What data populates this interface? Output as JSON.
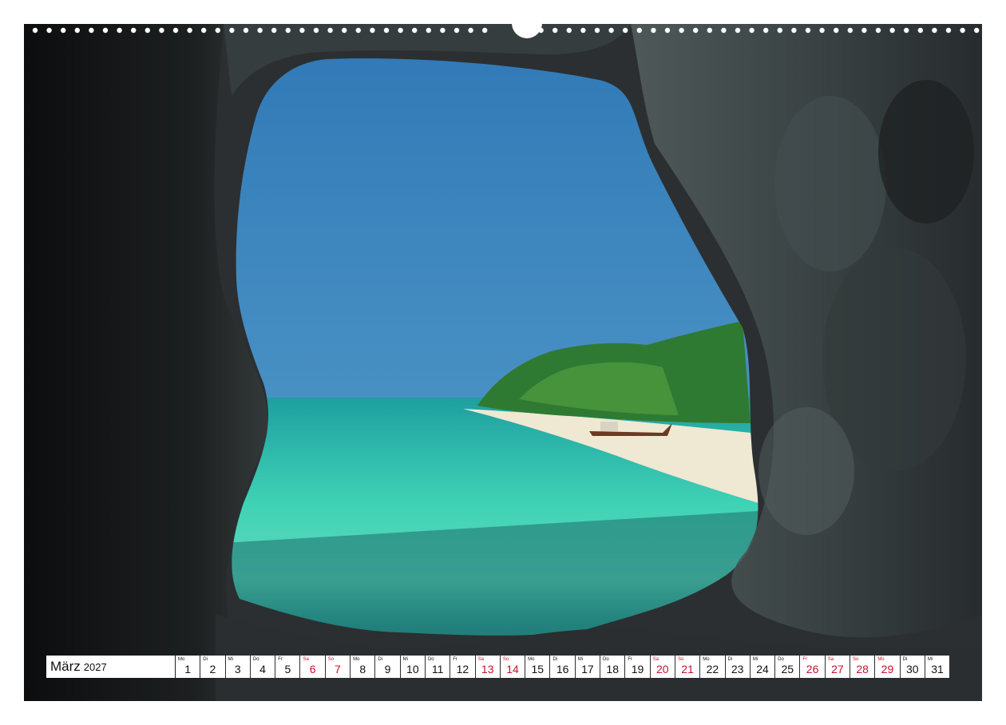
{
  "calendar": {
    "month": "März",
    "year": "2027",
    "days": [
      {
        "dow": "Mo",
        "day": "1",
        "weekend": false
      },
      {
        "dow": "Di",
        "day": "2",
        "weekend": false
      },
      {
        "dow": "Mi",
        "day": "3",
        "weekend": false
      },
      {
        "dow": "Do",
        "day": "4",
        "weekend": false
      },
      {
        "dow": "Fr",
        "day": "5",
        "weekend": false
      },
      {
        "dow": "Sa",
        "day": "6",
        "weekend": true
      },
      {
        "dow": "So",
        "day": "7",
        "weekend": true
      },
      {
        "dow": "Mo",
        "day": "8",
        "weekend": false
      },
      {
        "dow": "Di",
        "day": "9",
        "weekend": false
      },
      {
        "dow": "Mi",
        "day": "10",
        "weekend": false
      },
      {
        "dow": "Do",
        "day": "11",
        "weekend": false
      },
      {
        "dow": "Fr",
        "day": "12",
        "weekend": false
      },
      {
        "dow": "Sa",
        "day": "13",
        "weekend": true
      },
      {
        "dow": "So",
        "day": "14",
        "weekend": true
      },
      {
        "dow": "Mo",
        "day": "15",
        "weekend": false
      },
      {
        "dow": "Di",
        "day": "16",
        "weekend": false
      },
      {
        "dow": "Mi",
        "day": "17",
        "weekend": false
      },
      {
        "dow": "Do",
        "day": "18",
        "weekend": false
      },
      {
        "dow": "Fr",
        "day": "19",
        "weekend": false
      },
      {
        "dow": "Sa",
        "day": "20",
        "weekend": true
      },
      {
        "dow": "So",
        "day": "21",
        "weekend": true
      },
      {
        "dow": "Mo",
        "day": "22",
        "weekend": false
      },
      {
        "dow": "Di",
        "day": "23",
        "weekend": false
      },
      {
        "dow": "Mi",
        "day": "24",
        "weekend": false
      },
      {
        "dow": "Do",
        "day": "25",
        "weekend": false
      },
      {
        "dow": "Fr",
        "day": "26",
        "weekend": true
      },
      {
        "dow": "Sa",
        "day": "27",
        "weekend": true
      },
      {
        "dow": "So",
        "day": "28",
        "weekend": true
      },
      {
        "dow": "Mo",
        "day": "29",
        "weekend": true
      },
      {
        "dow": "Di",
        "day": "30",
        "weekend": false
      },
      {
        "dow": "Mi",
        "day": "31",
        "weekend": false
      }
    ]
  },
  "colors": {
    "weekend": "#c8102e",
    "sky": "#3f86bd",
    "sea": "#33c9b0",
    "rock": "#2c2f31"
  },
  "photo": {
    "icon": "cave-beach-photo-icon"
  }
}
